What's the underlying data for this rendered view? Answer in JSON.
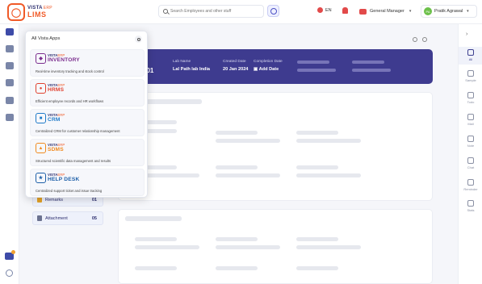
{
  "header": {
    "logo_top": "VISTA",
    "logo_top_suffix": "ERP",
    "logo_bottom": "LIMS",
    "search_placeholder": "Search Employees and other stuff",
    "language": "EN",
    "role": "General Manager",
    "user_initials": "PA",
    "user_name": "Pratik Agrawal"
  },
  "banner": {
    "number_fragment": "001",
    "lab_name_label": "Lab Name",
    "lab_name_value": "Lal Path lab India",
    "created_label": "Created Date",
    "created_value": "20 Jan 2024",
    "completion_label": "Completion Date",
    "completion_value": "Add Date"
  },
  "left_list": [
    {
      "label": "Remarks",
      "count": "01"
    },
    {
      "label": "Attachment",
      "count": "05"
    }
  ],
  "apps_popup": {
    "title": "All Vista Apps",
    "apps": [
      {
        "brand": "VISTA",
        "brand_suffix": "ERP",
        "name": "INVENTORY",
        "color": "#7b2d8e",
        "desc": "Real-time inventory tracking and stock control"
      },
      {
        "brand": "VISTA",
        "brand_suffix": "ERP",
        "name": "HRMS",
        "color": "#e0412f",
        "desc": "Efficient employee records and HR workflows"
      },
      {
        "brand": "VISTA",
        "brand_suffix": "ERP",
        "name": "CRM",
        "color": "#1f7ac8",
        "desc": "Centralized CRM for customer relationship management"
      },
      {
        "brand": "VISTA",
        "brand_suffix": "ERP",
        "name": "SDMS",
        "color": "#f08a20",
        "desc": "Structured scientific data management and results"
      },
      {
        "brand": "VISTA",
        "brand_suffix": "ERP",
        "name": "HELP DESK",
        "color": "#1d5fa8",
        "desc": "Centralized support ticket and issue tracking"
      }
    ]
  },
  "right_rail": [
    {
      "label": "All",
      "icon": "grid-icon",
      "selected": true
    },
    {
      "label": "Sample",
      "icon": "flask-icon"
    },
    {
      "label": "Todo",
      "icon": "list-icon"
    },
    {
      "label": "Mail",
      "icon": "mail-icon"
    },
    {
      "label": "Note",
      "icon": "pencil-icon"
    },
    {
      "label": "Chat",
      "icon": "chat-icon"
    },
    {
      "label": "Reminder",
      "icon": "clock-icon"
    },
    {
      "label": "Stats",
      "icon": "pie-icon"
    }
  ]
}
